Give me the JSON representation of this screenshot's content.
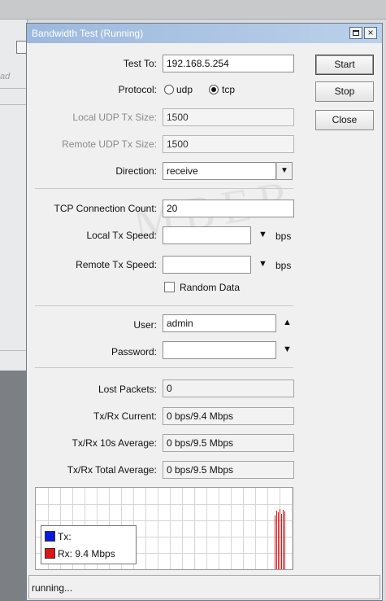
{
  "window": {
    "title": "Bandwidth Test (Running)",
    "maximize_glyph": "□",
    "close_glyph": "×"
  },
  "background": {
    "partial_text": "ad"
  },
  "form": {
    "test_to": {
      "label": "Test To:",
      "value": "192.168.5.254"
    },
    "protocol": {
      "label": "Protocol:",
      "options": [
        "udp",
        "tcp"
      ],
      "selected": "tcp"
    },
    "local_udp_tx_size": {
      "label": "Local UDP Tx Size:",
      "value": "1500"
    },
    "remote_udp_tx_size": {
      "label": "Remote UDP Tx Size:",
      "value": "1500"
    },
    "direction": {
      "label": "Direction:",
      "value": "receive"
    },
    "tcp_connection_count": {
      "label": "TCP Connection Count:",
      "value": "20"
    },
    "local_tx_speed": {
      "label": "Local Tx Speed:",
      "value": "",
      "unit": "bps"
    },
    "remote_tx_speed": {
      "label": "Remote Tx Speed:",
      "value": "",
      "unit": "bps"
    },
    "random_data": {
      "label": "Random Data",
      "checked": false
    },
    "user": {
      "label": "User:",
      "value": "admin"
    },
    "password": {
      "label": "Password:",
      "value": ""
    }
  },
  "stats": {
    "lost_packets": {
      "label": "Lost Packets:",
      "value": "0"
    },
    "txrx_current": {
      "label": "Tx/Rx Current:",
      "value": "0 bps/9.4 Mbps"
    },
    "txrx_10s_avg": {
      "label": "Tx/Rx 10s Average:",
      "value": "0 bps/9.5 Mbps"
    },
    "txrx_total_avg": {
      "label": "Tx/Rx Total Average:",
      "value": "0 bps/9.5 Mbps"
    }
  },
  "buttons": {
    "start": "Start",
    "stop": "Stop",
    "close": "Close"
  },
  "graph": {
    "legend": [
      {
        "label": "Tx:",
        "color": "#0a1adc"
      },
      {
        "label": "Rx:  9.4 Mbps",
        "color": "#e01414"
      }
    ],
    "rx_bar_color": "#d21a1a"
  },
  "status": {
    "text": "running..."
  },
  "watermark": {
    "text": "MBER"
  }
}
